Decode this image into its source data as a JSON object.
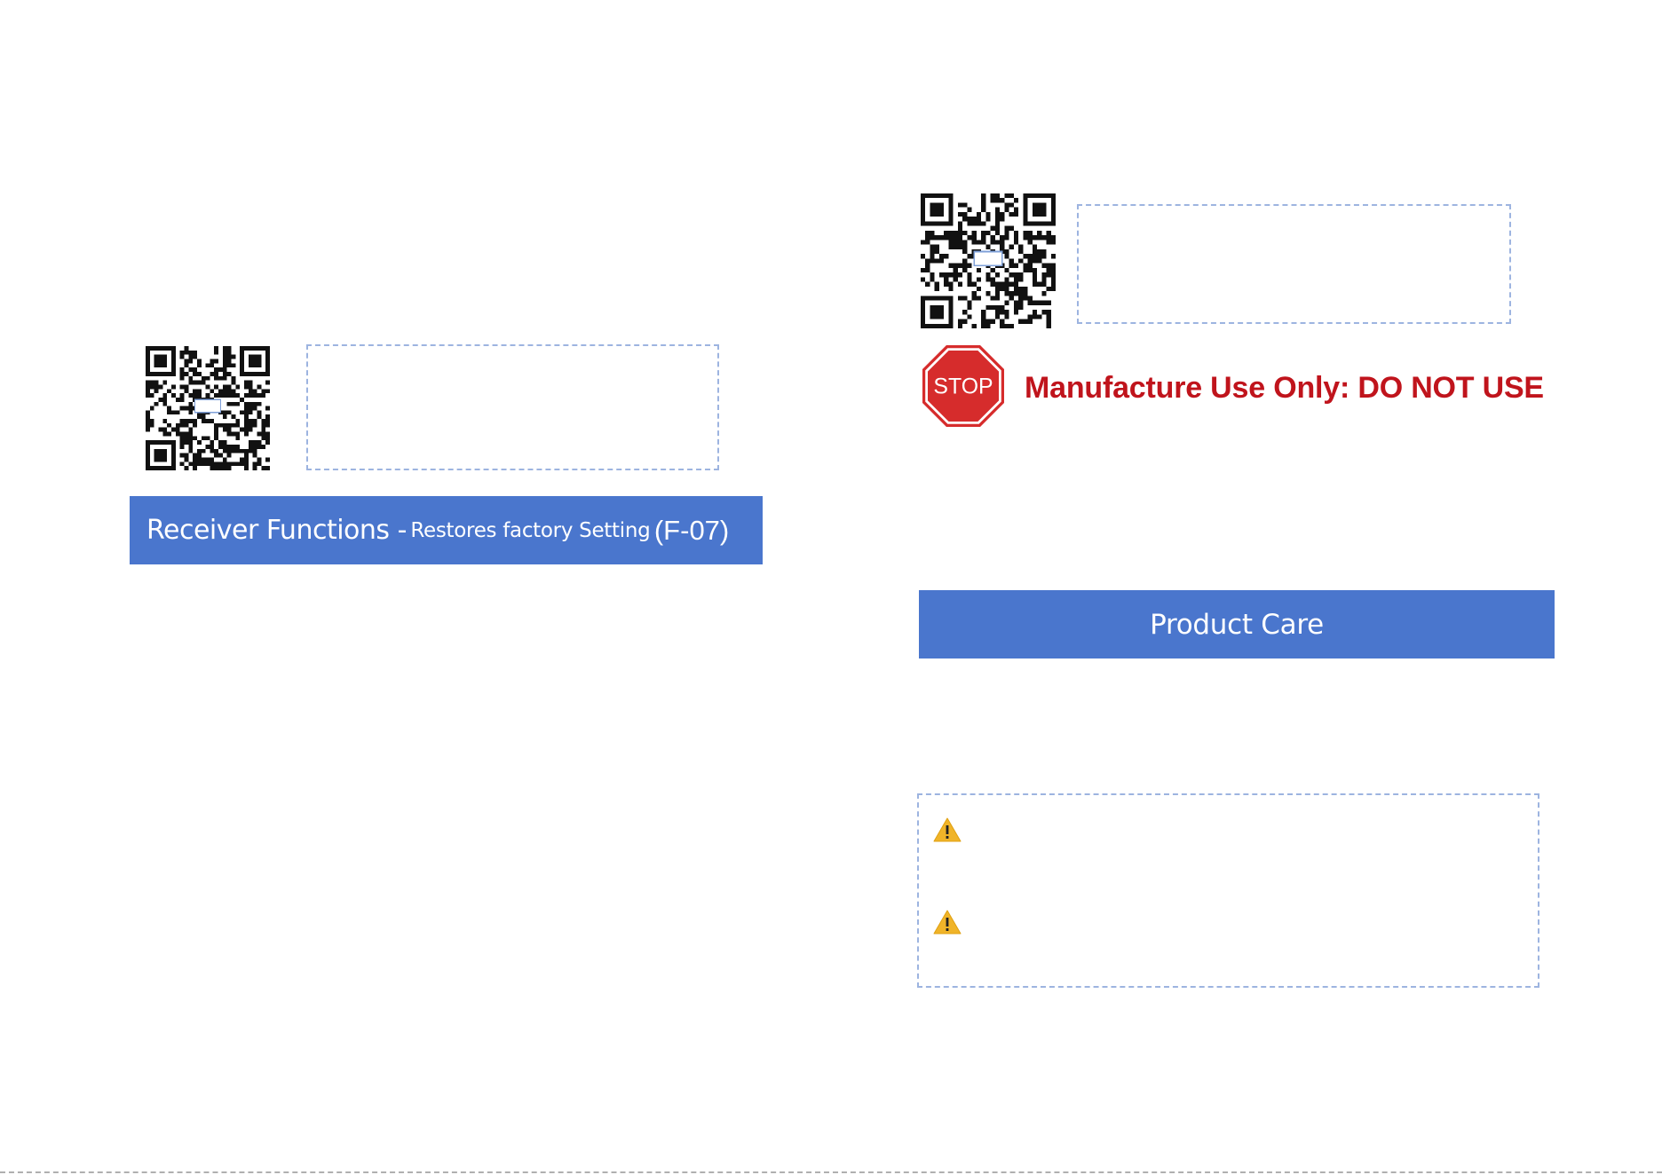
{
  "left_page": {
    "section_bar": {
      "title_large": "Receiver Functions -",
      "title_small": "Restores factory Setting",
      "function_code": "(F-07)"
    }
  },
  "right_page": {
    "warning_banner": {
      "icon": "stop-sign-icon",
      "stop_label": "STOP",
      "text": "Manufacture Use Only: DO NOT USE",
      "color": "#c0141c"
    },
    "section_bar": {
      "title": "Product Care"
    },
    "caution_box": {
      "icons": [
        "warning-triangle-icon",
        "warning-triangle-icon"
      ]
    }
  },
  "colors": {
    "bar_blue": "#4a76cd",
    "dashed_border": "#9db4e0",
    "warning_yellow": "#f0b429"
  },
  "qr_codes": [
    "qr-code-icon",
    "qr-code-icon"
  ]
}
